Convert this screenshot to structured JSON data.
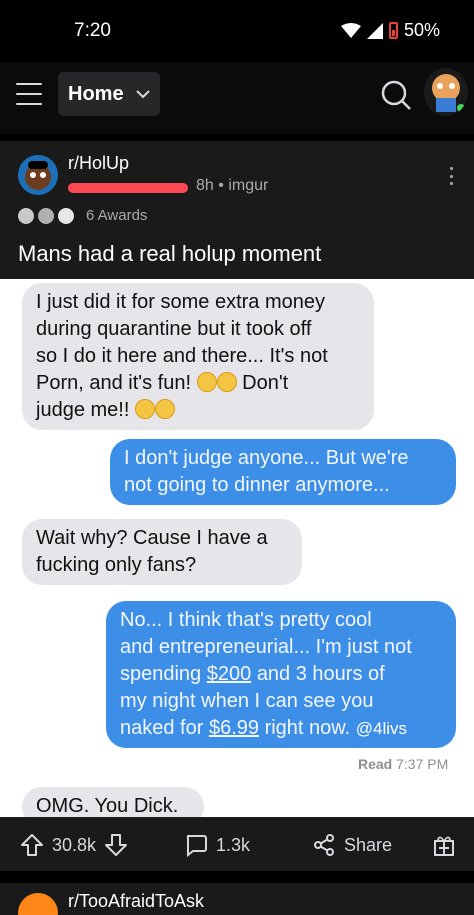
{
  "status_bar": {
    "time": "7:20",
    "battery": "50%"
  },
  "top_bar": {
    "feed_label": "Home"
  },
  "post": {
    "subreddit": "r/HolUp",
    "age": "8h",
    "separator": "•",
    "source": "imgur",
    "awards_label": "6 Awards",
    "title": "Mans had a real holup moment",
    "messages": [
      {
        "side": "in",
        "lines": [
          "I just did it for some extra money",
          "during quarantine but it took off",
          "so I do it here and there... It's not",
          "Porn, and it's fun!",
          "Don't",
          "judge me!!"
        ]
      },
      {
        "side": "out",
        "lines": [
          "I don't judge anyone... But we're",
          "not going to dinner anymore..."
        ]
      },
      {
        "side": "in",
        "lines": [
          "Wait why? Cause I have a",
          "fucking only fans?"
        ]
      },
      {
        "side": "out",
        "lines": [
          "No... I think that's pretty cool",
          "and entrepreneurial... I'm just not",
          "spending",
          "$200",
          "and 3 hours of",
          "my night when I can see you",
          "naked for",
          "$6.99",
          "right now.",
          "@4livs"
        ]
      },
      {
        "side": "in",
        "lines": [
          "OMG. You Dick."
        ]
      }
    ],
    "read_receipt": {
      "label": "Read",
      "time": "7:37 PM"
    },
    "upvotes": "30.8k",
    "comments": "1.3k",
    "share_label": "Share"
  },
  "next_post": {
    "subreddit": "r/TooAfraidToAsk"
  },
  "colors": {
    "accent": "#d93a00",
    "bubble_out": "#3d8ee6",
    "bubble_in": "#e5e5ea",
    "card": "#1a1a1b"
  }
}
